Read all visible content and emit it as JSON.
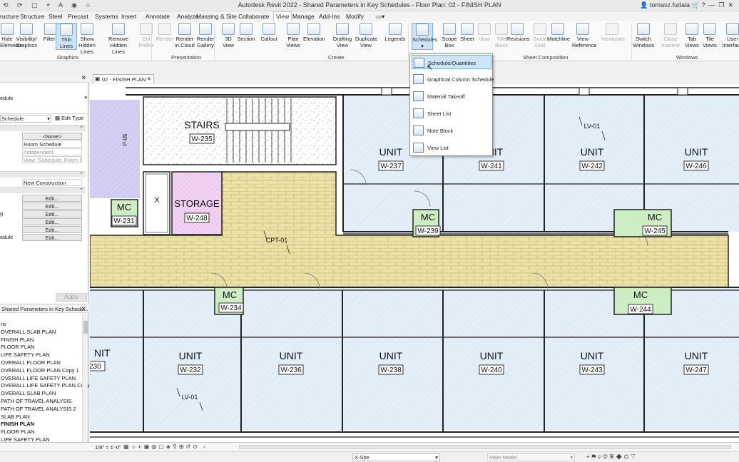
{
  "window": {
    "title": "Autodesk Revit 2022 - Shared Parameters in Key Schedules - Floor Plan: 02 - FINISH PLAN",
    "user": "tomasz.fudala",
    "icons": [
      "quick-access-icons",
      "user-icon",
      "cart-icon",
      "help-icon",
      "minimize-icon",
      "restore-icon",
      "close-icon"
    ]
  },
  "menu_tabs": [
    "ructure",
    "Structure",
    "Steel",
    "Precast",
    "Systems",
    "Insert",
    "Annotate",
    "Analyze",
    "Massing & Site",
    "Collaborate",
    "View",
    "Manage",
    "Add-Ins",
    "Modify"
  ],
  "active_tab": "View",
  "ribbon": {
    "buttons": [
      {
        "l1": "Hide",
        "l2": "Elements"
      },
      {
        "l1": "Visibility/",
        "l2": "Graphics"
      },
      {
        "l1": "Filters",
        "l2": ""
      },
      {
        "l1": "Thin",
        "l2": "Lines"
      },
      {
        "l1": "Show",
        "l2": "Hidden Lines"
      },
      {
        "l1": "Remove",
        "l2": "Hidden Lines"
      },
      {
        "l1": "Cut",
        "l2": "Profile"
      },
      {
        "l1": "Render",
        "l2": ""
      },
      {
        "l1": "Render",
        "l2": "in Cloud"
      },
      {
        "l1": "Render",
        "l2": "Gallery"
      },
      {
        "l1": "3D",
        "l2": "View"
      },
      {
        "l1": "Section",
        "l2": ""
      },
      {
        "l1": "Callout",
        "l2": ""
      },
      {
        "l1": "Plan",
        "l2": "Views"
      },
      {
        "l1": "Elevation",
        "l2": ""
      },
      {
        "l1": "Drafting",
        "l2": "View"
      },
      {
        "l1": "Duplicate",
        "l2": "View"
      },
      {
        "l1": "Legends",
        "l2": ""
      },
      {
        "l1": "Schedules",
        "l2": ""
      },
      {
        "l1": "Scope",
        "l2": "Box"
      },
      {
        "l1": "Sheet",
        "l2": ""
      },
      {
        "l1": "View",
        "l2": ""
      },
      {
        "l1": "Title",
        "l2": "Block"
      },
      {
        "l1": "Revisions",
        "l2": ""
      },
      {
        "l1": "Guide",
        "l2": "Grid"
      },
      {
        "l1": "Matchline",
        "l2": ""
      },
      {
        "l1": "View",
        "l2": "Reference"
      },
      {
        "l1": "Viewports",
        "l2": ""
      },
      {
        "l1": "Switch",
        "l2": "Windows"
      },
      {
        "l1": "Close",
        "l2": "Inactive"
      },
      {
        "l1": "Tab",
        "l2": "Views"
      },
      {
        "l1": "Tile",
        "l2": "Views"
      },
      {
        "l1": "User",
        "l2": "Interface"
      }
    ],
    "panels": [
      "Graphics",
      "Presentation",
      "Create",
      "Sheet Composition",
      "Windows"
    ]
  },
  "schedules_menu": [
    "Schedule/Quantities",
    "Graphical Column Schedule",
    "Material Takeoff",
    "Sheet List",
    "Note Block",
    "View List"
  ],
  "properties": {
    "type_name": "edule",
    "selector": "Schedule",
    "edit_type": "Edit Type",
    "rows": [
      {
        "label": "",
        "value": "<None>",
        "kind": "btn"
      },
      {
        "label": "",
        "value": "Room Schedule",
        "kind": "val"
      },
      {
        "label": "",
        "value": "Independent",
        "kind": "gray"
      },
      {
        "label": "",
        "value": "View \"Schedule: Room S...",
        "kind": "gray"
      },
      {
        "label": "",
        "value": "New Construction",
        "kind": "val"
      },
      {
        "label": "",
        "value": "Edit...",
        "kind": "btn"
      },
      {
        "label": "",
        "value": "Edit...",
        "kind": "btn"
      },
      {
        "label": "g",
        "value": "Edit...",
        "kind": "btn"
      },
      {
        "label": "",
        "value": "Edit...",
        "kind": "btn"
      },
      {
        "label": "",
        "value": "Edit...",
        "kind": "btn"
      },
      {
        "label": "edule",
        "value": "Edit...",
        "kind": "btn"
      }
    ],
    "apply": "Apply"
  },
  "browser": {
    "title": "Shared Parameters in Key Schedu...",
    "items": [
      "ns",
      "OVERALL SLAB PLAN",
      "FINISH PLAN",
      "FLOOR PLAN",
      "LIFE SAFETY PLAN",
      "OVERALL FLOOR PLAN",
      "OVERALL FLOOR PLAN Copy 1",
      "OVERALL LIFE SAFETY PLAN",
      "OVERALL LIFE SAFETY PLAN Copy",
      "OVERALL SLAB PLAN",
      "PATH OF TRAVEL ANALYSIS",
      "PATH OF TRAVEL ANALYSIS 2",
      "SLAB PLAN",
      "FINISH PLAN",
      "FLOOR PLAN",
      "LIFE SAFETY PLAN"
    ],
    "bold_index": 13
  },
  "view_tab": "02 - FINISH PLAN",
  "plan": {
    "stairs": "STAIRS",
    "stairs_tag": "W-235",
    "storage": "STORAGE",
    "storage_tag": "W-248",
    "p_tag": "P-05",
    "mc": [
      {
        "name": "MC",
        "tag": "W-231"
      },
      {
        "name": "MC",
        "tag": "W-239"
      },
      {
        "name": "MC",
        "tag": "W-245"
      },
      {
        "name": "MC",
        "tag": "W-234"
      },
      {
        "name": "MC",
        "tag": "W-244"
      }
    ],
    "top_units": [
      {
        "name": "UNIT",
        "tag": "W-237"
      },
      {
        "name": "UNIT",
        "tag": "W-241"
      },
      {
        "name": "UNIT",
        "tag": "W-242"
      },
      {
        "name": "UNIT",
        "tag": "W-246"
      }
    ],
    "bottom_units": [
      {
        "name": "NIT",
        "tag": "230"
      },
      {
        "name": "UNIT",
        "tag": "W-232"
      },
      {
        "name": "UNIT",
        "tag": "W-236"
      },
      {
        "name": "UNIT",
        "tag": "W-238"
      },
      {
        "name": "UNIT",
        "tag": "W-240"
      },
      {
        "name": "UNIT",
        "tag": "W-243"
      },
      {
        "name": "UNIT",
        "tag": "W-247"
      }
    ],
    "finish_tags": [
      "LV-01",
      "CPT-01",
      "LV-01"
    ],
    "cross": "X",
    "colors": {
      "corridor": "#ece2a8",
      "brick": "#c7b87a",
      "unit": "#e3eef8",
      "storage": "#f1d1f1",
      "stair": "#ffffff",
      "mc": "#cdeec5",
      "purple": "#d4d0f3"
    }
  },
  "status": {
    "scale": "1/8\" = 1'-0\"",
    "workset": "X-Site",
    "model": "Main Model"
  }
}
